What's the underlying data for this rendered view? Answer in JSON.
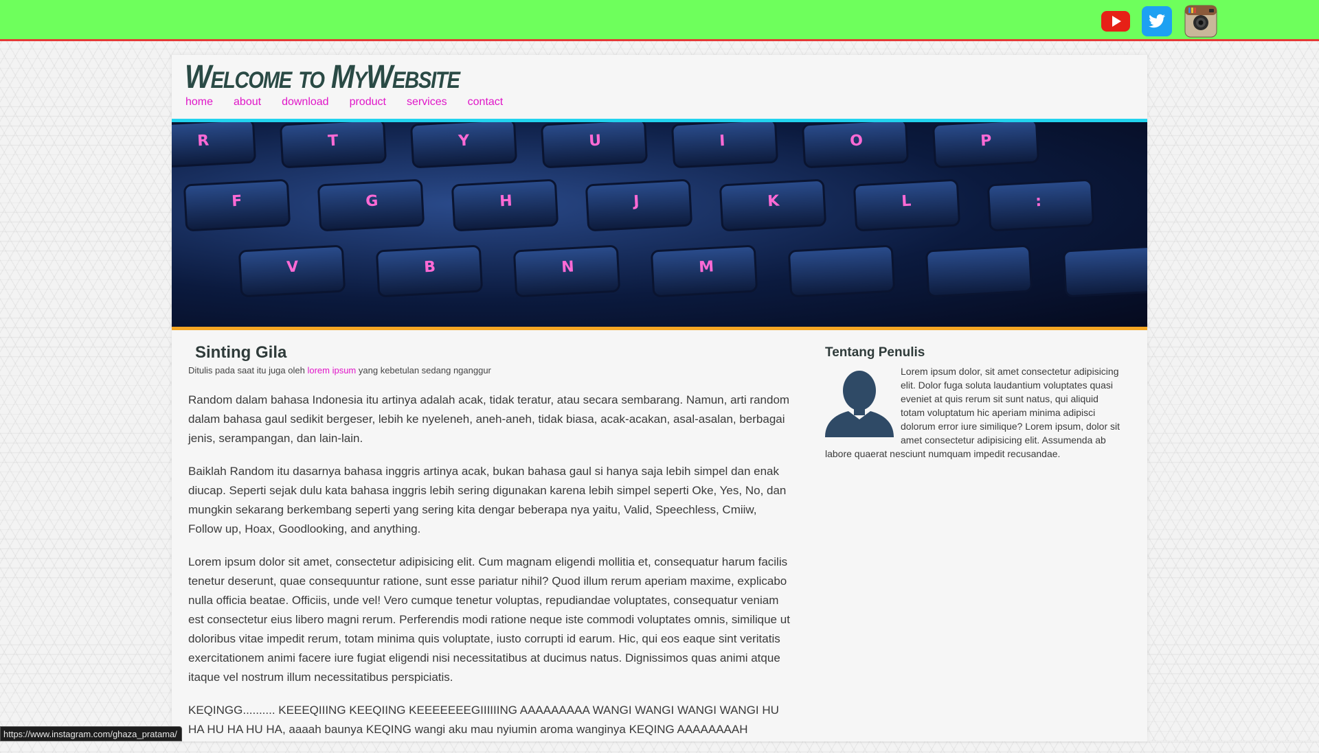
{
  "social": {
    "youtube": "youtube-icon",
    "twitter": "twitter-icon",
    "instagram": "instagram-icon"
  },
  "header": {
    "site_title": "Welcome to MyWebsite",
    "nav": [
      "home",
      "about",
      "download",
      "product",
      "services",
      "contact"
    ]
  },
  "hero": {
    "row1": [
      "R",
      "T",
      "Y",
      "U",
      "I",
      "O",
      "P"
    ],
    "row2": [
      "F",
      "G",
      "H",
      "J",
      "K",
      "L",
      ":"
    ],
    "row3": [
      "V",
      "B",
      "N",
      "M"
    ]
  },
  "post": {
    "title": "Sinting Gila",
    "byline_prefix": "Ditulis pada saat itu juga oleh",
    "byline_author": "lorem ipsum",
    "byline_suffix": "yang kebetulan sedang nganggur",
    "paragraphs": [
      "Random dalam bahasa Indonesia itu artinya adalah acak, tidak teratur, atau secara sembarang. Namun, arti random dalam bahasa gaul sedikit bergeser, lebih ke nyeleneh, aneh-aneh, tidak biasa, acak-acakan, asal-asalan, berbagai jenis, serampangan, dan lain-lain.",
      "Baiklah Random itu dasarnya bahasa inggris artinya acak, bukan bahasa gaul si hanya saja lebih simpel dan enak diucap. Seperti sejak dulu kata bahasa inggris lebih sering digunakan karena lebih simpel seperti Oke, Yes, No, dan mungkin sekarang berkembang seperti yang sering kita dengar beberapa nya yaitu, Valid, Speechless, Cmiiw, Follow up, Hoax, Goodlooking, and anything.",
      "Lorem ipsum dolor sit amet, consectetur adipisicing elit. Cum magnam eligendi mollitia et, consequatur harum facilis tenetur deserunt, quae consequuntur ratione, sunt esse pariatur nihil? Quod illum rerum aperiam maxime, explicabo nulla officia beatae. Officiis, unde vel! Vero cumque tenetur voluptas, repudiandae voluptates, consequatur veniam est consectetur eius libero magni rerum. Perferendis modi ratione neque iste commodi voluptates omnis, similique ut doloribus vitae impedit rerum, totam minima quis voluptate, iusto corrupti id earum. Hic, qui eos eaque sint veritatis exercitationem animi facere iure fugiat eligendi nisi necessitatibus at ducimus natus. Dignissimos quas animi atque itaque vel nostrum illum necessitatibus perspiciatis.",
      "KEQINGG.......... KEEEQIIING KEEQIING KEEEEEEEGIIIIIING AAAAAAAAA WANGI WANGI WANGI WANGI HU HA HU HA HU HA, aaaah baunya KEQING wangi aku mau nyiumin aroma wanginya KEQING AAAAAAAAH"
    ]
  },
  "sidebar": {
    "title": "Tentang Penulis",
    "text": "Lorem ipsum dolor, sit amet consectetur adipisicing elit. Dolor fuga soluta laudantium voluptates quasi eveniet at quis rerum sit sunt natus, qui aliquid totam voluptatum hic aperiam minima adipisci dolorum error iure similique? Lorem ipsum, dolor sit amet consectetur adipisicing elit. Assumenda ab labore quaerat nesciunt numquam impedit recusandae."
  },
  "status_url": "https://www.instagram.com/ghaza_pratama/",
  "colors": {
    "topbar": "#6eff5c",
    "topbar_border": "#e53935",
    "link": "#e016c8",
    "hero_top_border": "#22d3ee",
    "hero_bottom_border": "#f5a623",
    "title": "#2a4a45"
  }
}
